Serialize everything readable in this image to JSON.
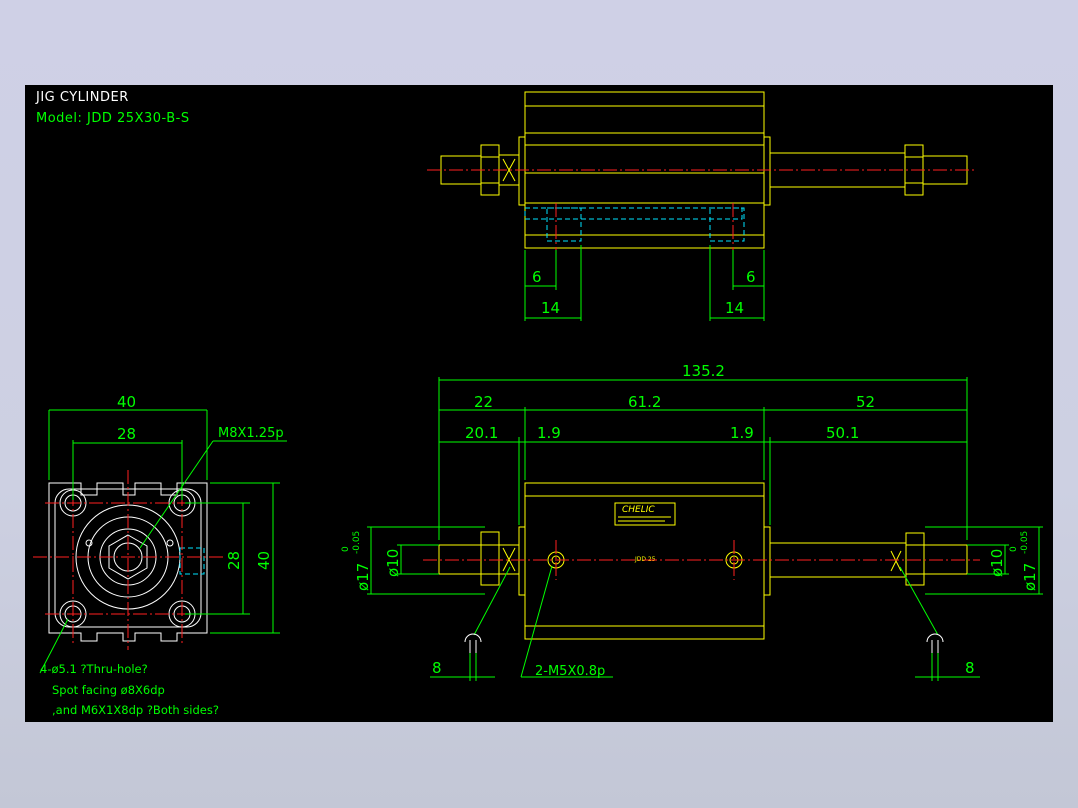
{
  "title": {
    "line1": "JIG CYLINDER",
    "line2": "Model:  JDD 25X30-B-S"
  },
  "colors": {
    "background": "#000000",
    "dimension": "#00ff00",
    "outline": "#ffff00",
    "centerline": "#ff2020",
    "hidden": "#00e5ff",
    "title": "#ffffff"
  },
  "top_view": {
    "dims": {
      "left_6": "6",
      "right_6": "6",
      "left_14": "14",
      "right_14": "14"
    }
  },
  "end_view": {
    "dims": {
      "width_40": "40",
      "width_28": "28",
      "height_28": "28",
      "height_40": "40"
    },
    "thread_label": "M8X1.25p",
    "note1": "4-ø5.1 ?Thru-hole?",
    "note2": "Spot facing  ø8X6dp",
    "note3": ",and  M6X1X8dp ?Both sides?"
  },
  "front_view": {
    "dims": {
      "overall": "135.2",
      "d22": "22",
      "d61_2": "61.2",
      "d52": "52",
      "d20_1": "20.1",
      "d1_9_left": "1.9",
      "d1_9_right": "1.9",
      "d50_1": "50.1",
      "left_8": "8",
      "right_8": "8",
      "dia10_left": "ø10",
      "dia17_left": "ø17",
      "dia10_right": "ø10",
      "dia17_right": "ø17",
      "tol_upper": "0",
      "tol_lower": "-0.05"
    },
    "port_label": "2-M5X0.8p",
    "brand": "CHELIC",
    "bore_label": "JDD 25"
  }
}
